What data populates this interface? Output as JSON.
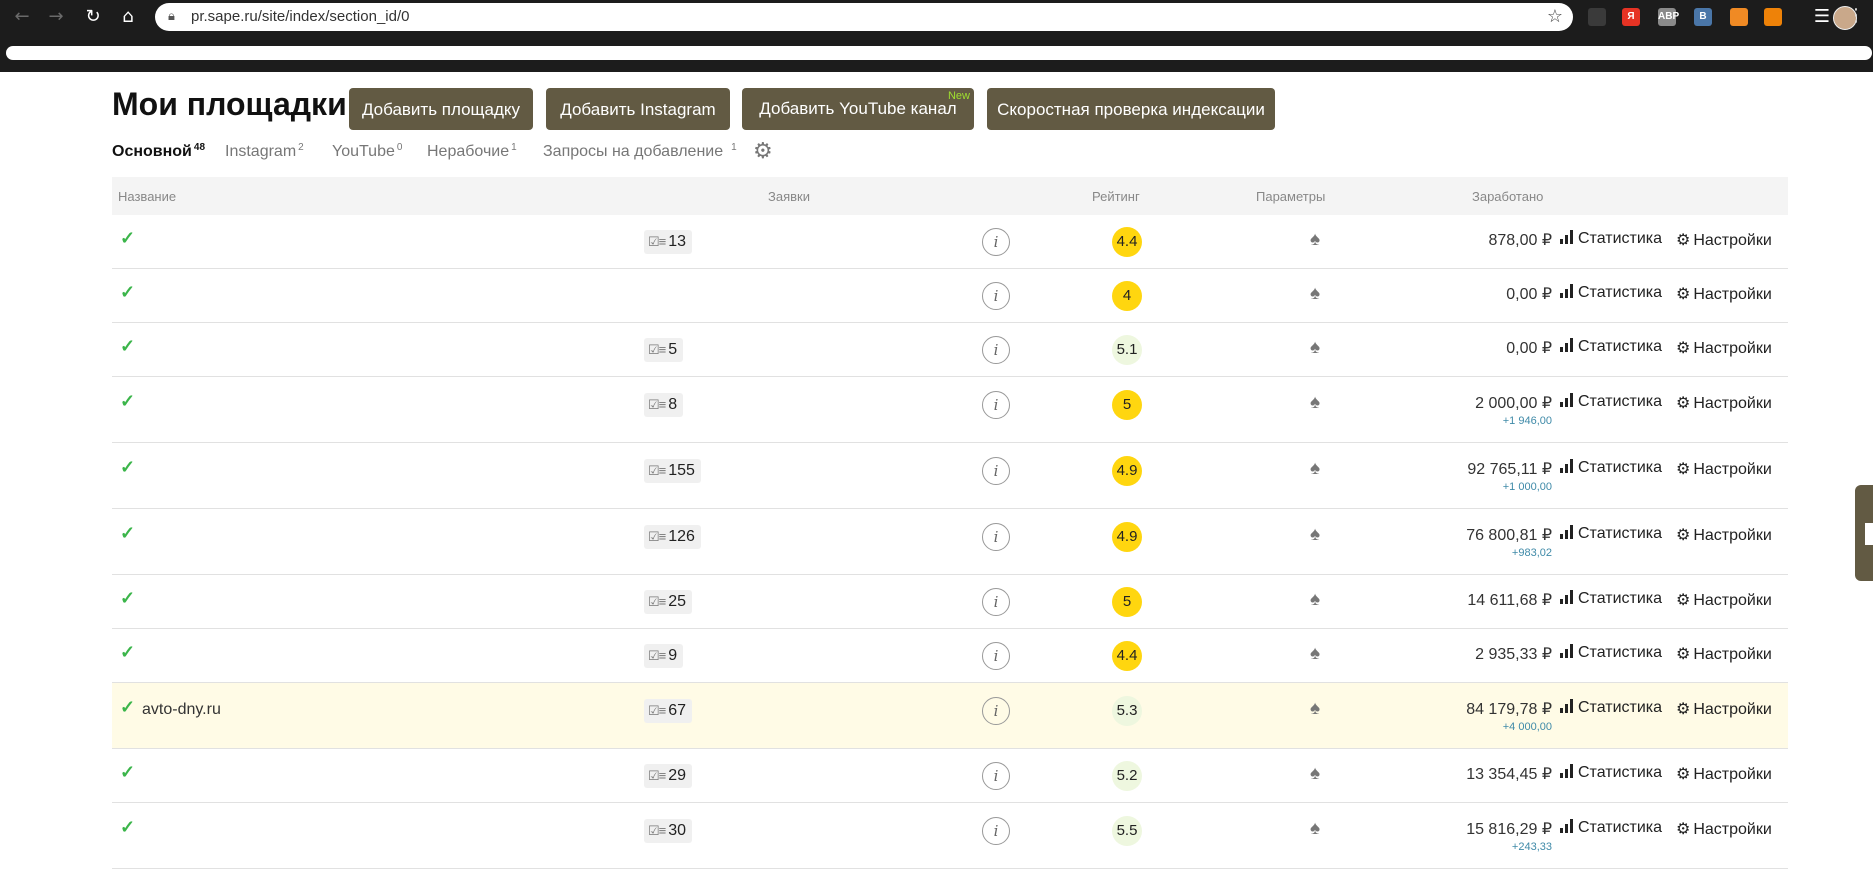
{
  "browser": {
    "url": "pr.sape.ru/site/index/section_id/0",
    "extensions": [
      {
        "name": "shield-ext-icon",
        "label": "",
        "color": "#3a3a3a"
      },
      {
        "name": "yandex-ext-icon",
        "label": "Я",
        "color": "#e63324"
      },
      {
        "name": "adblock-ext-icon",
        "label": "ABP",
        "color": "#8a8a8a"
      },
      {
        "name": "vk-ext-icon",
        "label": "В",
        "color": "#4a76a8"
      },
      {
        "name": "rss-ext-icon",
        "label": "",
        "color": "#f08a24"
      },
      {
        "name": "ok-ext-icon",
        "label": "",
        "color": "#ee8208"
      }
    ]
  },
  "header": {
    "title": "Мои площадки",
    "buttons": {
      "add_site": "Добавить площадку",
      "add_instagram": "Добавить Instagram",
      "add_youtube": "Добавить YouTube канал",
      "new_badge": "New",
      "fast_check": "Скоростная проверка индексации"
    }
  },
  "tabs": [
    {
      "label": "Основной",
      "count": "48"
    },
    {
      "label": "Instagram",
      "count": "2"
    },
    {
      "label": "YouTube",
      "count": "0"
    },
    {
      "label": "Нерабочие",
      "count": "1"
    },
    {
      "label": "Запросы на добавление",
      "count": "1"
    }
  ],
  "table": {
    "columns": {
      "name": "Название",
      "requests": "Заявки",
      "rating": "Рейтинг",
      "params": "Параметры",
      "earned": "Заработано"
    },
    "stat_label": "Статистика",
    "settings_label": "Настройки",
    "info_label": "i",
    "rows": [
      {
        "site": "",
        "requests": "13",
        "rating": "4.4",
        "rating_level": "hi",
        "earned": "878,00 ₽",
        "delta": "",
        "highlight": false
      },
      {
        "site": "",
        "requests": "",
        "rating": "4",
        "rating_level": "hi",
        "earned": "0,00 ₽",
        "delta": "",
        "highlight": false
      },
      {
        "site": "",
        "requests": "5",
        "rating": "5.1",
        "rating_level": "lo",
        "earned": "0,00 ₽",
        "delta": "",
        "highlight": false
      },
      {
        "site": "",
        "requests": "8",
        "rating": "5",
        "rating_level": "hi",
        "earned": "2 000,00 ₽",
        "delta": "+1 946,00",
        "highlight": false
      },
      {
        "site": "",
        "requests": "155",
        "rating": "4.9",
        "rating_level": "hi",
        "earned": "92 765,11 ₽",
        "delta": "+1 000,00",
        "highlight": false
      },
      {
        "site": "",
        "requests": "126",
        "rating": "4.9",
        "rating_level": "hi",
        "earned": "76 800,81 ₽",
        "delta": "+983,02",
        "highlight": false
      },
      {
        "site": "",
        "requests": "25",
        "rating": "5",
        "rating_level": "hi",
        "earned": "14 611,68 ₽",
        "delta": "",
        "highlight": false
      },
      {
        "site": "",
        "requests": "9",
        "rating": "4.4",
        "rating_level": "hi",
        "earned": "2 935,33 ₽",
        "delta": "",
        "highlight": false
      },
      {
        "site": "avto-dny.ru",
        "requests": "67",
        "rating": "5.3",
        "rating_level": "lo",
        "earned": "84 179,78 ₽",
        "delta": "+4 000,00",
        "highlight": true
      },
      {
        "site": "",
        "requests": "29",
        "rating": "5.2",
        "rating_level": "lo",
        "earned": "13 354,45 ₽",
        "delta": "",
        "highlight": false
      },
      {
        "site": "",
        "requests": "30",
        "rating": "5.5",
        "rating_level": "lo",
        "earned": "15 816,29 ₽",
        "delta": "+243,33",
        "highlight": false
      }
    ]
  },
  "colors": {
    "button_bg": "#625a43",
    "new_badge": "#9fe02f",
    "rating_high": "#ffd60f",
    "rating_low": "#eef7df",
    "check": "#3bb54a",
    "highlight_row": "#fffbe6",
    "delta": "#3f8aa8"
  }
}
